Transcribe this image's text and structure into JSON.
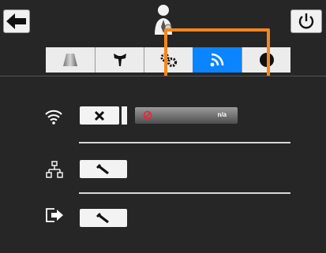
{
  "header": {
    "back_icon": "arrow-left-icon",
    "user_icon": "user-profile-icon",
    "power_icon": "power-icon"
  },
  "tabs": [
    {
      "icon": "cone-icon",
      "active": false
    },
    {
      "icon": "tool-icon",
      "active": false
    },
    {
      "icon": "gear-settings-icon",
      "active": false
    },
    {
      "icon": "wifi-signal-icon",
      "active": true
    },
    {
      "icon": "info-icon",
      "active": false
    }
  ],
  "wifi_row": {
    "status_value": "n/a"
  },
  "colors": {
    "active_tab": "#0a84ff",
    "highlight": "#f5861f",
    "background": "#262626"
  }
}
